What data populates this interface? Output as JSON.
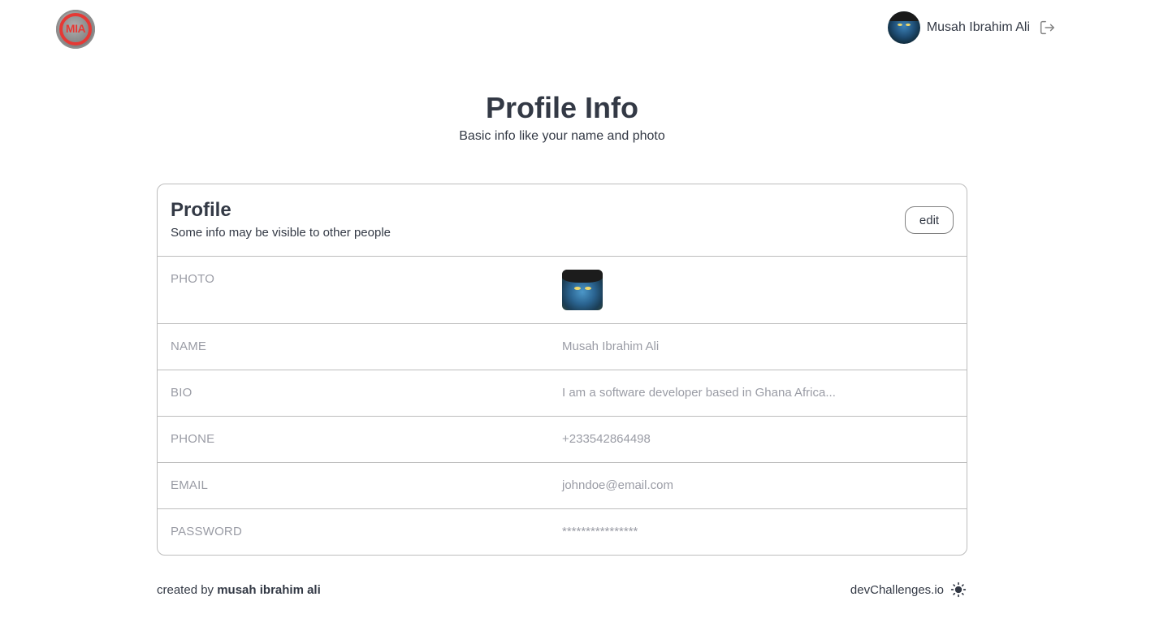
{
  "header": {
    "logo_text": "MIA",
    "user_name": "Musah Ibrahim Ali",
    "logout_icon": "logout-icon"
  },
  "page": {
    "title": "Profile Info",
    "subtitle": "Basic info like your name and photo"
  },
  "card": {
    "title": "Profile",
    "subtitle": "Some info may be visible to other people",
    "edit_label": "edit",
    "rows": [
      {
        "label": "PHOTO",
        "value": ""
      },
      {
        "label": "NAME",
        "value": "Musah Ibrahim Ali"
      },
      {
        "label": "BIO",
        "value": "I am a software developer based in Ghana Africa..."
      },
      {
        "label": "PHONE",
        "value": "+233542864498"
      },
      {
        "label": "EMAIL",
        "value": "johndoe@email.com"
      },
      {
        "label": "PASSWORD",
        "value": "****************"
      }
    ]
  },
  "footer": {
    "created_prefix": "created by",
    "author": "musah ibrahim ali",
    "site": "devChallenges.io",
    "theme_icon": "sun-icon"
  },
  "colors": {
    "text": "#333945",
    "muted": "#9a9ca5",
    "border": "#bdbdbd",
    "logo_red": "#e53935"
  }
}
